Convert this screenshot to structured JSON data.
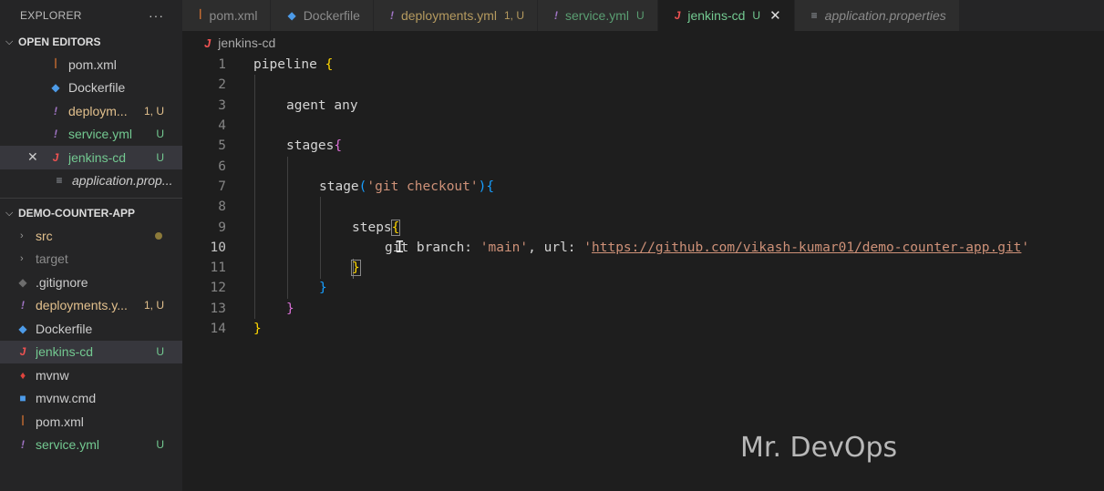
{
  "sidebar": {
    "title": "EXPLORER",
    "more": "···",
    "open_editors": {
      "label": "OPEN EDITORS",
      "items": [
        {
          "name": "pom.xml",
          "status": ""
        },
        {
          "name": "Dockerfile",
          "status": ""
        },
        {
          "name": "deploym...",
          "status": "1, U"
        },
        {
          "name": "service.yml",
          "status": "U"
        },
        {
          "name": "jenkins-cd",
          "status": "U",
          "close": "✕"
        },
        {
          "name": "application.prop...",
          "status": ""
        }
      ]
    },
    "project": {
      "label": "DEMO-COUNTER-APP",
      "items": [
        {
          "name": "src",
          "status": ""
        },
        {
          "name": "target",
          "status": ""
        },
        {
          "name": ".gitignore",
          "status": ""
        },
        {
          "name": "deployments.y...",
          "status": "1, U"
        },
        {
          "name": "Dockerfile",
          "status": ""
        },
        {
          "name": "jenkins-cd",
          "status": "U"
        },
        {
          "name": "mvnw",
          "status": ""
        },
        {
          "name": "mvnw.cmd",
          "status": ""
        },
        {
          "name": "pom.xml",
          "status": ""
        },
        {
          "name": "service.yml",
          "status": "U"
        }
      ]
    }
  },
  "tabs": [
    {
      "name": "pom.xml",
      "status": ""
    },
    {
      "name": "Dockerfile",
      "status": ""
    },
    {
      "name": "deployments.yml",
      "status": "1, U"
    },
    {
      "name": "service.yml",
      "status": "U"
    },
    {
      "name": "jenkins-cd",
      "status": "U",
      "close": "✕"
    },
    {
      "name": "application.properties",
      "status": ""
    }
  ],
  "editor": {
    "breadcrumb": "jenkins-cd",
    "current_line": 10,
    "lines": [
      {
        "n": "1",
        "text": "pipeline {"
      },
      {
        "n": "2",
        "text": ""
      },
      {
        "n": "3",
        "text": "agent any"
      },
      {
        "n": "4",
        "text": ""
      },
      {
        "n": "5",
        "text": "stages{"
      },
      {
        "n": "6",
        "text": ""
      },
      {
        "n": "7",
        "text": "stage('git checkout'){"
      },
      {
        "n": "8",
        "text": ""
      },
      {
        "n": "9",
        "text": "steps{"
      },
      {
        "n": "10",
        "text": "git branch: 'main', url: 'https://github.com/vikash-kumar01/demo-counter-app.git'"
      },
      {
        "n": "11",
        "text": "}"
      },
      {
        "n": "12",
        "text": "}"
      },
      {
        "n": "13",
        "text": "}"
      },
      {
        "n": "14",
        "text": "}"
      }
    ],
    "tokens": {
      "pipeline": "pipeline",
      "agent": "agent any",
      "stages": "stages",
      "stage": "stage",
      "stage_arg": "'git checkout'",
      "steps": "steps",
      "git_cmd": "git branch: ",
      "branch_val": "'main'",
      "url_key": ", url: ",
      "url_quote": "'",
      "url_val": "https://github.com/vikash-kumar01/demo-counter-app.git",
      "url_end": "'"
    }
  },
  "watermark": "Mr. DevOps",
  "colors": {
    "accent_untracked": "#73c991",
    "modified_yellow": "#e2c08d",
    "bracket_gold": "#ffd700",
    "bracket_purple": "#da70d6",
    "bracket_blue": "#179fff",
    "string": "#ce9178"
  }
}
